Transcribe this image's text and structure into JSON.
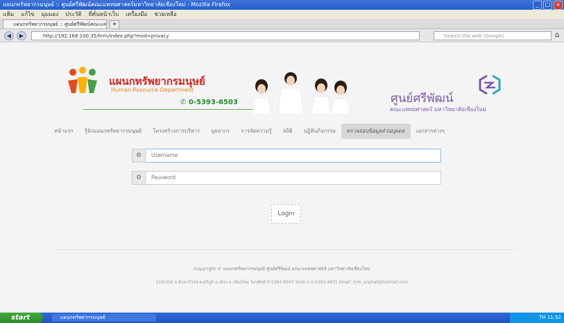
{
  "browser": {
    "window_title": "แผนกทรัพยากรมนุษย์ :: ศูนย์ศรีพัฒน์คณะแพทยศาสตร์มหาวิทยาลัยเชียงใหม่ - Mozilla Firefox",
    "menu": [
      "แฟ้ม",
      "แก้ไข",
      "มุมมอง",
      "ประวัติ",
      "ที่คั่นหน้าเว็บ",
      "เครื่องมือ",
      "ช่วยเหลือ"
    ],
    "tab_label": "แผนกทรัพยากรมนุษย์ :: ศูนย์ศรีพัฒน์คณะแพทยฯ...",
    "tab_add": "+",
    "url": "http://192.168.100.35/hrm/index.php?mod=privacy",
    "search_placeholder": "Search the web (Google)",
    "back_icon": "◀",
    "forward_icon": "▶",
    "home_icon": "⌂"
  },
  "header": {
    "org_name": "แผนกทรัพยากรมนุษย์",
    "org_name_en": "Human Resource Department",
    "phone": "0-5393-6503",
    "center_name": "ศูนย์ศรีพัฒน์",
    "center_sub": "คณะแพทยศาสตร์ มหาวิทยาลัยเชียงใหม่"
  },
  "menu": [
    {
      "label": "หน้าแรก",
      "active": false
    },
    {
      "label": "รู้จักแผนกทรัพยากรมนุษย์",
      "active": false
    },
    {
      "label": "โครงสร้างการบริหาร",
      "active": false
    },
    {
      "label": "บุคลากร",
      "active": false
    },
    {
      "label": "การจัดความรู้",
      "active": false
    },
    {
      "label": "สถิติ",
      "active": false
    },
    {
      "label": "ปฏิทินกิจกรรม",
      "active": false
    },
    {
      "label": "ตรวจสอบข้อมูลส่วนบุคคล",
      "active": true
    },
    {
      "label": "เอกสารต่างๆ",
      "active": false
    }
  ],
  "login": {
    "username_placeholder": "Username",
    "password_placeholder": "Password",
    "username_icon": "⚙",
    "password_icon": "⚙",
    "button_label": "Login"
  },
  "footer": {
    "copyright": "Copyright © แผนกทรัพยากรมนุษย์ ศูนย์ศรีพัฒน์ คณะแพทยศาสตร์ มหาวิทยาลัยเชียงใหม่",
    "address": "110/392 ถ.อินทวโรรส ต.ศรีภูมิ อ.เมือง จ.เชียงใหม่ โทรศัพท์ 0-5394-6503 โทรสาร 0-5393-4931 Email: hrm_sriphat@hotmail.com"
  },
  "taskbar": {
    "start_label": "start",
    "task_label": "แผนกทรัพยากรมนุษย์",
    "tray": "TH 11:52"
  },
  "colors": {
    "brand_red": "#d5231b",
    "brand_orange": "#f08020",
    "phone_green": "#1c8d2a",
    "center_purple": "#7a5aa8",
    "xp_blue": "#245fd0"
  }
}
